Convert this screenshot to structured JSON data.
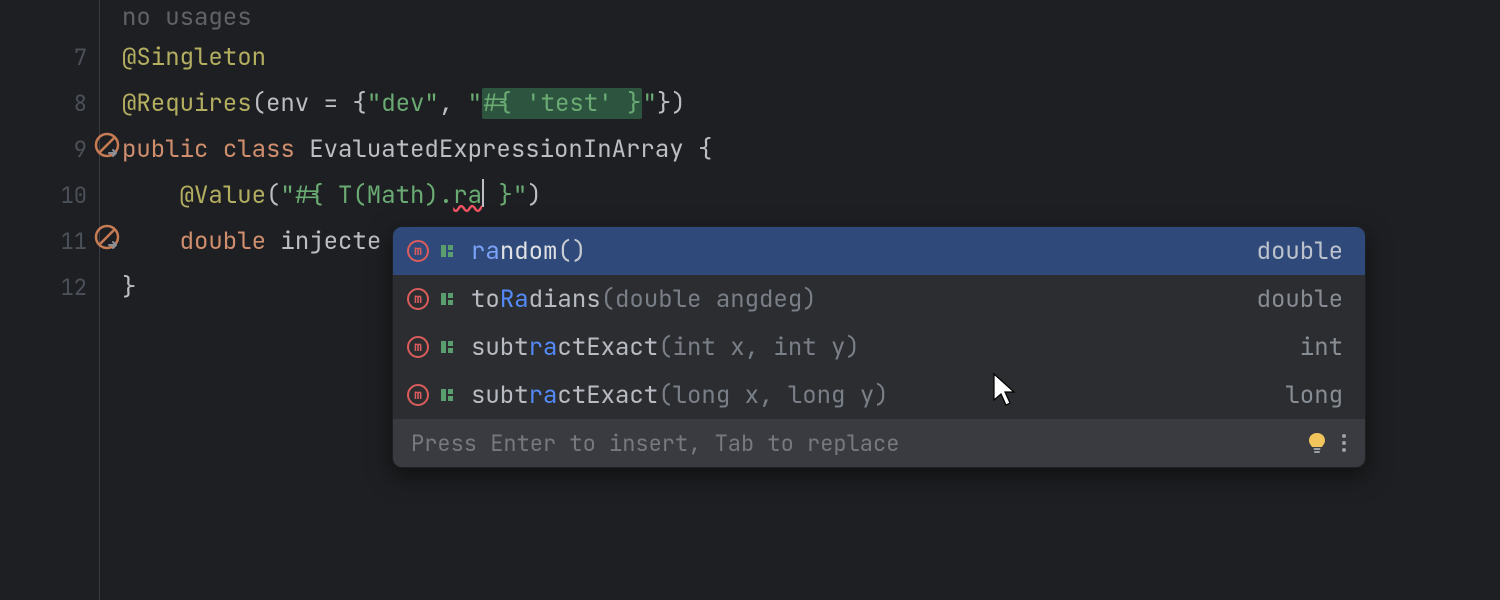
{
  "usages_hint": "no usages",
  "lines": {
    "l7": "7",
    "l8": "8",
    "l9": "9",
    "l10": "10",
    "l11": "11",
    "l12": "12"
  },
  "code": {
    "singleton_at": "@",
    "singleton": "Singleton",
    "requires_at": "@",
    "requires": "Requires",
    "requires_open": "(env = {",
    "dev_str": "\"dev\"",
    "comma": ", ",
    "test_open_q": "\"",
    "test_expr": "#{ 'test' }",
    "test_close_q": "\"",
    "requires_close": "})",
    "public": "public",
    "class_kw": "class",
    "class_name": "EvaluatedExpressionInArray",
    "obrace": " {",
    "value_at": "    @",
    "value": "Value",
    "value_open": "(",
    "value_q1": "\"",
    "value_prefix": "#{ T(Math).",
    "value_typed": "ra",
    "value_suffix": " }",
    "value_q2": "\"",
    "value_close": ")",
    "indent": "    ",
    "double_kw": "double",
    "injected_var": "injecte",
    "cbrace": "}"
  },
  "popup": {
    "hint": "Press Enter to insert, Tab to replace",
    "items": [
      {
        "match": "ra",
        "rest": "ndom",
        "sig": "()",
        "ret": "double"
      },
      {
        "match1": "to",
        "match2": "Ra",
        "rest": "dians",
        "sig": "(double angdeg)",
        "ret": "double"
      },
      {
        "match1": "subt",
        "match2": "ra",
        "rest": "ctExact",
        "sig": "(int x, int y)",
        "ret": "int"
      },
      {
        "match1": "subt",
        "match2": "ra",
        "rest": "ctExact",
        "sig": "(long x, long y)",
        "ret": "long"
      }
    ]
  }
}
